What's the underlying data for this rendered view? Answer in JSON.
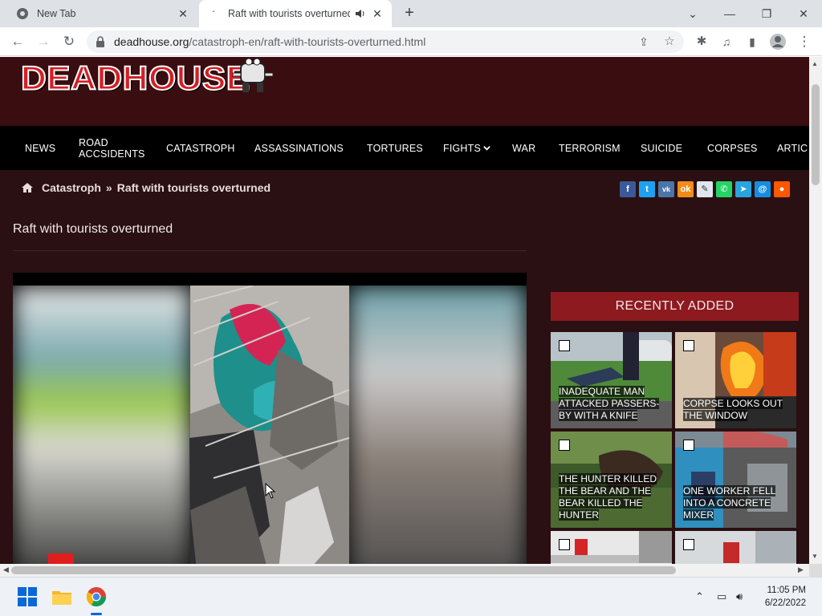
{
  "browser": {
    "tabs": [
      {
        "title": "New Tab",
        "active": false
      },
      {
        "title": "Raft with tourists overturned",
        "active": true
      }
    ],
    "url_host": "deadhouse.org",
    "url_path": "/catastroph-en/raft-with-tourists-overturned.html"
  },
  "site": {
    "logo_text": "DEADHOUSE",
    "nav": [
      "NEWS",
      "ROAD ACCSIDENTS",
      "CATASTROPH",
      "ASSASSINATIONS",
      "TORTURES",
      "FIGHTS",
      "WAR",
      "TERRORISM",
      "SUICIDE",
      "CORPSES",
      "ARTIC"
    ],
    "nav_dropdown_icon": "chevron-down-icon"
  },
  "breadcrumb": {
    "section": "Catastroph",
    "separator": "»",
    "current": "Raft with tourists overturned"
  },
  "share_icons": [
    "facebook-icon",
    "twitter-icon",
    "vk-icon",
    "odnoklassniki-icon",
    "livejournal-icon",
    "whatsapp-icon",
    "telegram-icon",
    "email-icon",
    "reddit-icon"
  ],
  "post": {
    "title": "Raft with tourists overturned"
  },
  "sidebar": {
    "heading": "RECENTLY ADDED",
    "items": [
      {
        "caption": "INADEQUATE MAN ATTACKED PASSERS-BY WITH A KNIFE"
      },
      {
        "caption": "CORPSE LOOKS OUT THE WINDOW"
      },
      {
        "caption": "THE HUNTER KILLED THE BEAR AND THE BEAR KILLED THE HUNTER"
      },
      {
        "caption": "ONE WORKER FELL INTO A CONCRETE MIXER"
      },
      {
        "caption": ""
      },
      {
        "caption": ""
      }
    ]
  },
  "taskbar": {
    "time": "11:05 PM",
    "date": "6/22/2022"
  },
  "colors": {
    "header_bg": "#3a0d10",
    "page_bg": "#2a1012",
    "nav_bg": "#000000",
    "accent_red": "#8c1a1f"
  }
}
